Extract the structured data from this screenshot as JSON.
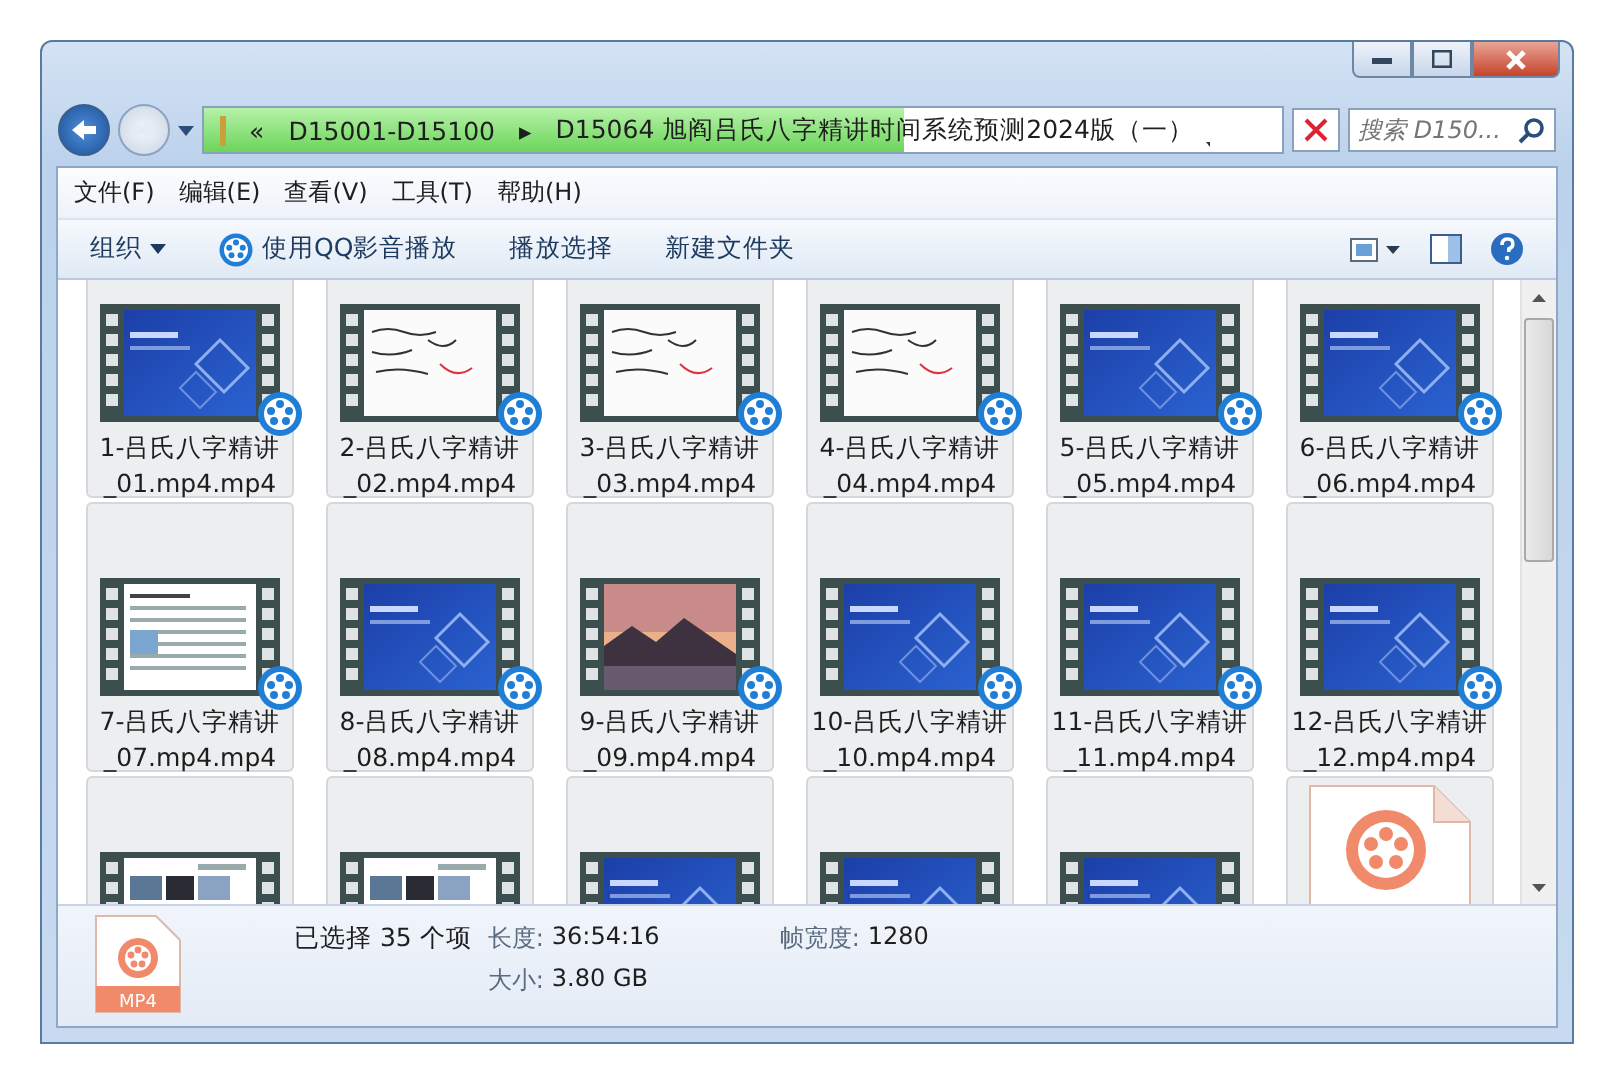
{
  "address_bar": {
    "level": 0.65,
    "crumbs": [
      "«",
      "D15001-D15100",
      "▸",
      "D15064 旭阎吕氏八字精讲时间系统预测2024版（一）"
    ]
  },
  "search": {
    "placeholder": "搜索 D150..."
  },
  "menu": [
    "文件(F)",
    "编辑(E)",
    "查看(V)",
    "工具(T)",
    "帮助(H)"
  ],
  "toolbar": [
    {
      "label": "组织",
      "kind": "dropdown"
    },
    {
      "label": "使用QQ影音播放",
      "kind": "player"
    },
    {
      "label": "播放选择",
      "kind": "plain"
    },
    {
      "label": "新建文件夹",
      "kind": "plain"
    }
  ],
  "files": [
    {
      "label": "1-吕氏八字精讲_01.mp4.mp4",
      "kind": "slide",
      "selected": true
    },
    {
      "label": "2-吕氏八字精讲_02.mp4.mp4",
      "kind": "whiteboard",
      "selected": true
    },
    {
      "label": "3-吕氏八字精讲_03.mp4.mp4",
      "kind": "whiteboard",
      "selected": true
    },
    {
      "label": "4-吕氏八字精讲_04.mp4.mp4",
      "kind": "whiteboard",
      "selected": true
    },
    {
      "label": "5-吕氏八字精讲_05.mp4.mp4",
      "kind": "slide",
      "selected": true
    },
    {
      "label": "6-吕氏八字精讲_06.mp4.mp4",
      "kind": "slide",
      "selected": true
    },
    {
      "label": "7-吕氏八字精讲_07.mp4.mp4",
      "kind": "document",
      "selected": true
    },
    {
      "label": "8-吕氏八字精讲_08.mp4.mp4",
      "kind": "slide",
      "selected": true
    },
    {
      "label": "9-吕氏八字精讲_09.mp4.mp4",
      "kind": "photo",
      "selected": true
    },
    {
      "label": "10-吕氏八字精讲_10.mp4.mp4",
      "kind": "slide",
      "selected": true
    },
    {
      "label": "11-吕氏八字精讲_11.mp4.mp4",
      "kind": "slide",
      "selected": true
    },
    {
      "label": "12-吕氏八字精讲_12.mp4.mp4",
      "kind": "slide",
      "selected": true
    },
    {
      "kind": "gallery",
      "selected": true
    },
    {
      "kind": "gallery",
      "selected": true
    },
    {
      "kind": "slide",
      "selected": true
    },
    {
      "kind": "slide",
      "selected": true
    },
    {
      "kind": "slide",
      "selected": true
    },
    {
      "kind": "file",
      "selected": true
    }
  ],
  "details": {
    "icon_label": "MP4",
    "selection": "已选择 35 个项",
    "fields": [
      {
        "label": "长度:",
        "value": "36:54:16"
      },
      {
        "label": "帧宽度:",
        "value": "1280"
      },
      {
        "label": "大小:",
        "value": "3.80 GB"
      }
    ]
  }
}
